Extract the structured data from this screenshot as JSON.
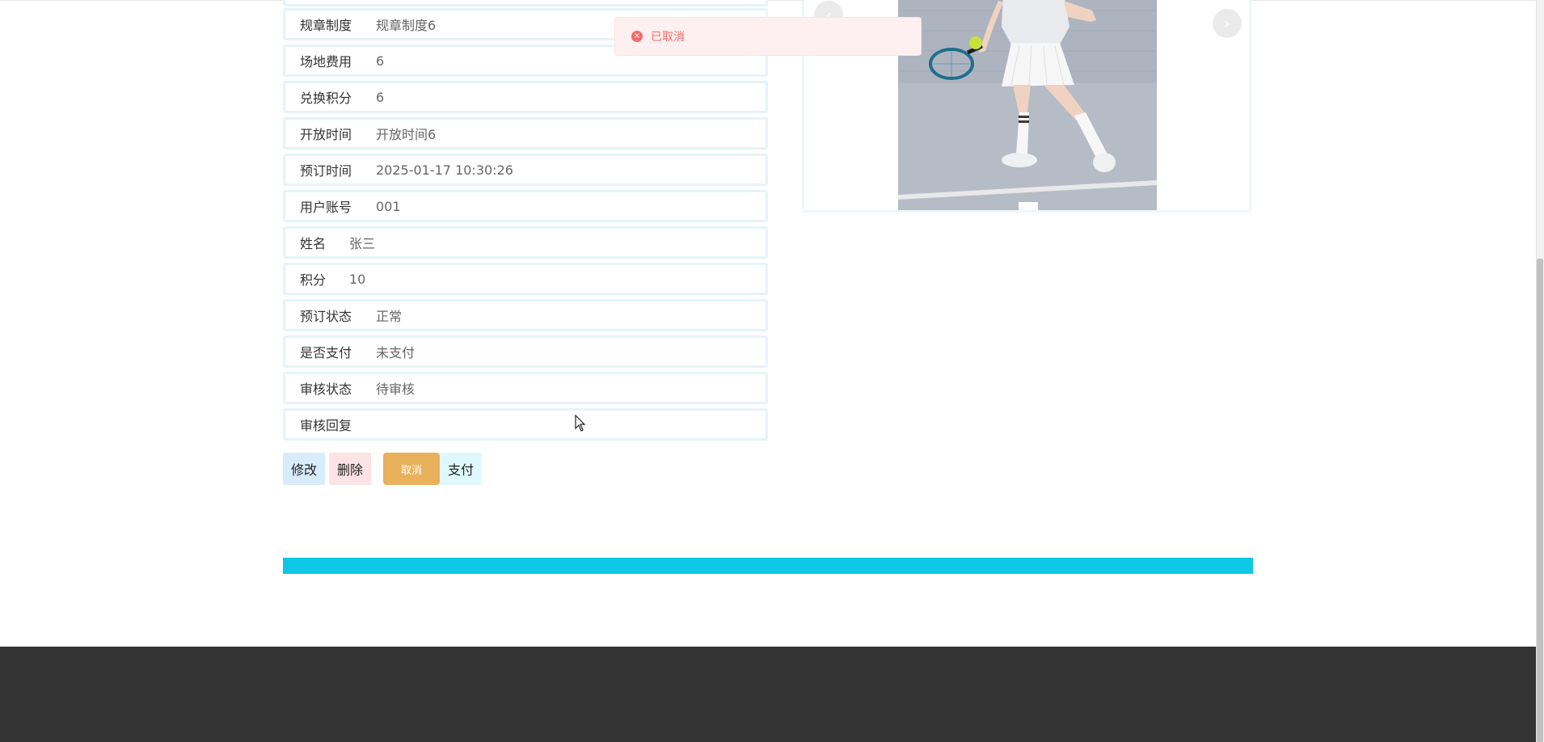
{
  "details": {
    "rows": [
      {
        "label": "规章制度",
        "value": "规章制度6"
      },
      {
        "label": "场地费用",
        "value": "6"
      },
      {
        "label": "兑换积分",
        "value": "6"
      },
      {
        "label": "开放时间",
        "value": "开放时间6"
      },
      {
        "label": "预订时间",
        "value": "2025-01-17 10:30:26"
      },
      {
        "label": "用户账号",
        "value": "001"
      },
      {
        "label": "姓名",
        "value": "张三"
      },
      {
        "label": "积分",
        "value": "10"
      },
      {
        "label": "预订状态",
        "value": "正常"
      },
      {
        "label": "是否支付",
        "value": "未支付"
      },
      {
        "label": "审核状态",
        "value": "待审核"
      },
      {
        "label": "审核回复",
        "value": ""
      }
    ]
  },
  "actions": {
    "edit_label": "修改",
    "delete_label": "删除",
    "cancel_label": "取消",
    "pay_label": "支付"
  },
  "toast": {
    "message": "已取消",
    "icon": "error-circle-icon"
  },
  "carousel": {
    "prev_icon": "chevron-left-icon",
    "next_icon": "chevron-right-icon",
    "slide_count_visible": 1
  },
  "colors": {
    "accent_bar": "#0dc8e4",
    "footer": "#333333",
    "cancel_button": "#e9b15b",
    "toast_text": "#f56c6c"
  }
}
